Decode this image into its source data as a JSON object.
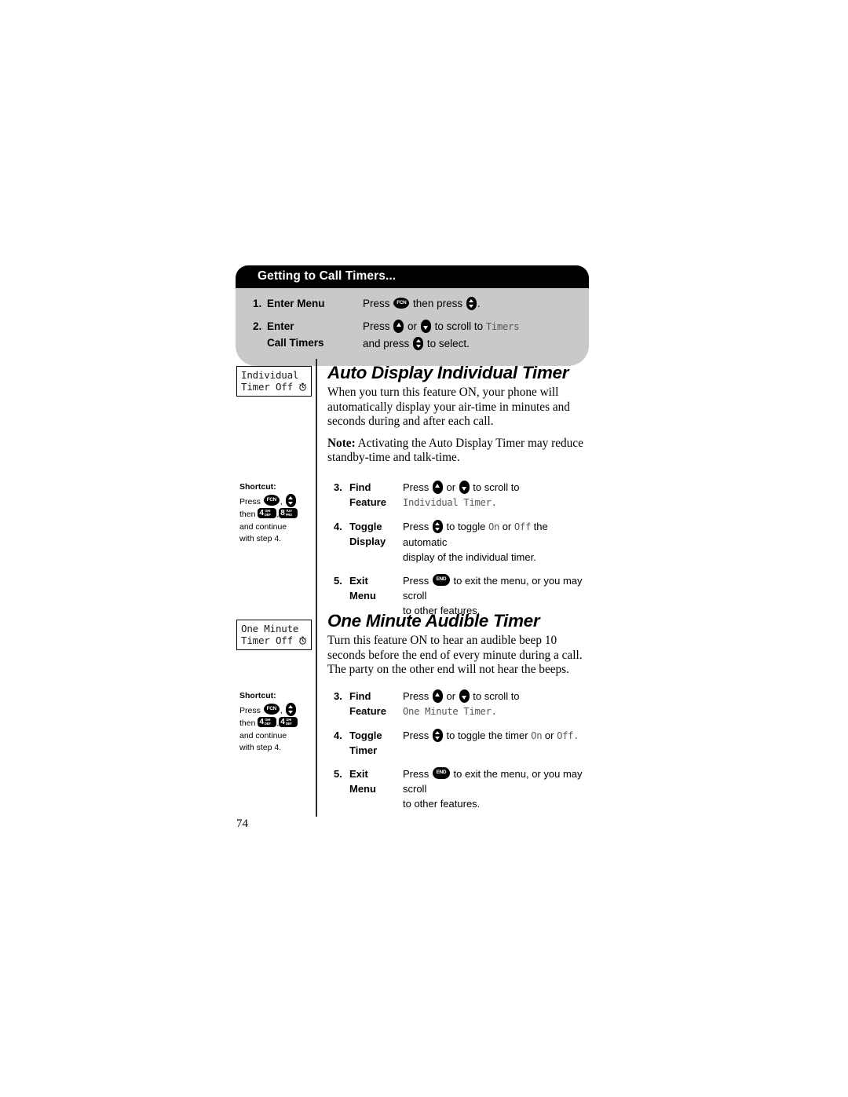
{
  "page": {
    "number": "74"
  },
  "callout": {
    "title": "Getting to Call Timers...",
    "steps": [
      {
        "num": "1.",
        "label_line1": "Enter Menu",
        "label_line2": "",
        "text_line1_a": "Press",
        "text_line1_b": "then press",
        "text_line1_c": ".",
        "text_line2": ""
      },
      {
        "num": "2.",
        "label_line1": "Enter",
        "label_line2": "Call Timers",
        "text_line1_a": "Press",
        "text_line1_b": "or",
        "text_line1_c": "to scroll to",
        "text_line1_display": "Timers",
        "text_line2_a": "and press",
        "text_line2_b": "to select."
      }
    ]
  },
  "sections": [
    {
      "id": "auto-display-individual-timer",
      "title": "Auto Display Individual Timer",
      "lcd": {
        "line1": "Individual",
        "line2": "Timer Off"
      },
      "paragraphs": [
        {
          "note_label": "",
          "text": "When you turn this feature ON, your phone will automatically display your air-time in minutes and seconds during and after each call."
        },
        {
          "note_label": "Note:",
          "text": " Activating the Auto Display Timer may reduce standby-time and talk-time."
        }
      ],
      "shortcut": {
        "title": "Shortcut:",
        "press_label": "Press",
        "then_label": "then",
        "key1": "4",
        "key1_sub1": "GHI",
        "key1_sub2": "DEF",
        "key2": "8",
        "key2_sub1": "TUV",
        "key2_sub2": "PRS",
        "line_continue": "and continue",
        "line_step": "with step 4."
      },
      "steps": [
        {
          "num": "3.",
          "label_line1": "Find",
          "label_line2": "Feature",
          "line1_a": "Press",
          "line1_b": "or",
          "line1_c": "to scroll to",
          "line2_display": "Individual Timer.",
          "line2_tail": ""
        },
        {
          "num": "4.",
          "label_line1": "Toggle",
          "label_line2": "Display",
          "line1_a": "Press",
          "line1_b": "to toggle",
          "line1_on": "On",
          "line1_or": "or",
          "line1_off": "Off",
          "line1_tail": "the automatic",
          "line2": "display of the individual timer."
        },
        {
          "num": "5.",
          "label_line1": "Exit",
          "label_line2": "Menu",
          "line1_a": "Press",
          "line1_b": "to exit the menu, or you may scroll",
          "line2": "to other features."
        }
      ]
    },
    {
      "id": "one-minute-audible-timer",
      "title": "One Minute Audible Timer",
      "lcd": {
        "line1": "One Minute",
        "line2": "Timer Off"
      },
      "paragraphs": [
        {
          "note_label": "",
          "text": "Turn this feature ON to hear an audible beep 10 seconds before the end of every minute during a call. The party on the other end will not hear the beeps."
        }
      ],
      "shortcut": {
        "title": "Shortcut:",
        "press_label": "Press",
        "then_label": "then",
        "key1": "4",
        "key1_sub1": "GHI",
        "key1_sub2": "DEF",
        "key2": "4",
        "key2_sub1": "GHI",
        "key2_sub2": "DEF",
        "line_continue": "and continue",
        "line_step": "with step 4."
      },
      "steps": [
        {
          "num": "3.",
          "label_line1": "Find",
          "label_line2": "Feature",
          "line1_a": "Press",
          "line1_b": "or",
          "line1_c": "to scroll to",
          "line2_display": "One Minute Timer.",
          "line2_tail": ""
        },
        {
          "num": "4.",
          "label_line1": "Toggle",
          "label_line2": "Timer",
          "line1_a": "Press",
          "line1_b": "to toggle the timer",
          "line1_on": "On",
          "line1_or": "or",
          "line1_off": "Off.",
          "line1_tail": "",
          "line2": ""
        },
        {
          "num": "5.",
          "label_line1": "Exit",
          "label_line2": "Menu",
          "line1_a": "Press",
          "line1_b": "to exit the menu, or you may scroll",
          "line2": "to other features."
        }
      ]
    }
  ],
  "icons": {
    "fcn_key": "fcn-key-icon",
    "end_key": "end-key-icon",
    "nav_select": "nav-select-key-icon",
    "nav_up": "nav-up-key-icon",
    "nav_down": "nav-down-key-icon",
    "clock": "clock-icon"
  }
}
